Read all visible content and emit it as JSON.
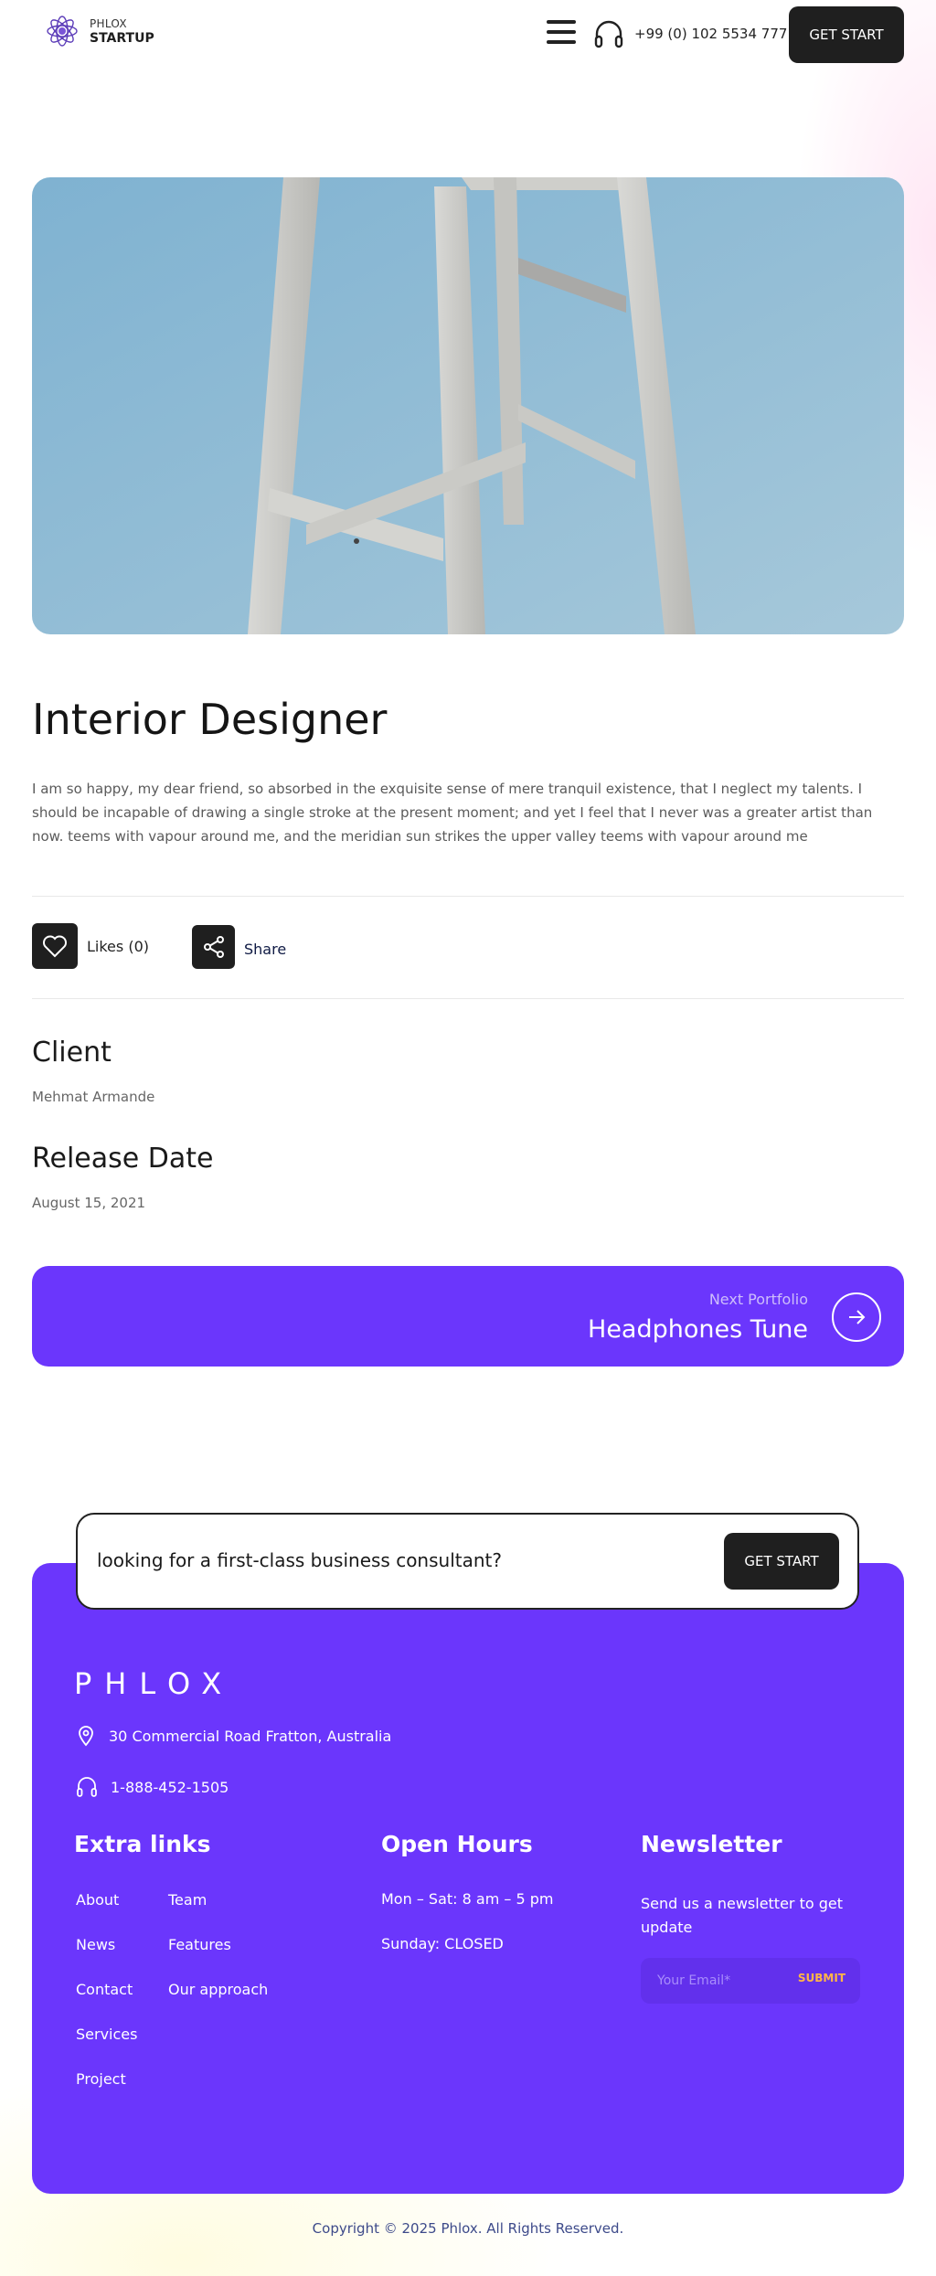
{
  "header": {
    "logo_line1": "PHLOX",
    "logo_line2": "STARTUP",
    "phone": "+99 (0) 102 5534 777",
    "cta_label": "GET START"
  },
  "portfolio": {
    "title": "Interior Designer",
    "description": "I am so happy, my dear friend, so absorbed in the exquisite sense of mere tranquil existence, that I neglect my talents. I should be incapable of drawing a single stroke at the present moment; and yet I feel that I never was a greater artist than now. teems with vapour around me, and the meridian sun strikes the upper valley teems with vapour around me",
    "likes_label": "Likes (0)",
    "share_label": "Share",
    "client_heading": "Client",
    "client_value": "Mehmat Armande",
    "release_heading": "Release Date",
    "release_value": "August 15, 2021"
  },
  "next": {
    "small_label": "Next Portfolio",
    "title": "Headphones Tune"
  },
  "cta_banner": {
    "text": "looking for a first-class business consultant?",
    "button_label": "GET START"
  },
  "footer": {
    "brand": "PHLOX",
    "address": "30 Commercial Road Fratton, Australia",
    "phone": "1-888-452-1505",
    "extra_links_heading": "Extra links",
    "links_col1": [
      "About",
      "News",
      "Contact",
      "Services",
      "Project"
    ],
    "links_col2": [
      "Team",
      "Features",
      "Our approach"
    ],
    "hours_heading": "Open Hours",
    "hours": [
      "Mon – Sat: 8 am – 5 pm",
      "Sunday: CLOSED"
    ],
    "newsletter_heading": "Newsletter",
    "newsletter_text": "Send us a newsletter to get update",
    "email_placeholder": "Your Email*",
    "submit_label": "SUBMIT"
  },
  "copyright": "Copyright © 2025 Phlox. All Rights Reserved.",
  "colors": {
    "accent": "#6b36fc",
    "dark_button": "#1f1f1f",
    "submit": "#ffb547"
  },
  "icons": [
    "lotus-logo-icon",
    "hamburger-icon",
    "headphones-icon",
    "heart-icon",
    "share-icon",
    "arrow-right-icon",
    "map-pin-icon",
    "headphones-icon"
  ]
}
